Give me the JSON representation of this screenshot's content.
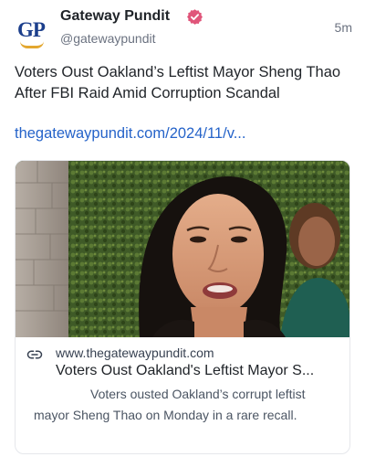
{
  "post": {
    "author": {
      "display_name": "Gateway Pundit",
      "handle": "@gatewaypundit",
      "avatar_text": "GP",
      "verified_icon": "verified-badge-icon"
    },
    "timestamp": "5m",
    "text": "Voters Oust Oakland’s Leftist Mayor Sheng Thao After FBI Raid Amid Corruption Scandal",
    "link_text": "thegatewaypundit.com/2024/11/v...",
    "colors": {
      "link": "#2563c9",
      "verified_badge": "#e0557a",
      "avatar_text": "#1c3f8c",
      "avatar_swoosh": "#e3a72f"
    }
  },
  "link_card": {
    "image_icon": "photo-of-woman-speaking",
    "link_icon": "link-icon",
    "domain": "www.thegatewaypundit.com",
    "title": "Voters Oust Oakland's Leftist Mayor S...",
    "description": "Voters ousted Oakland’s corrupt leftist mayor Sheng Thao on Monday in a rare recall."
  }
}
